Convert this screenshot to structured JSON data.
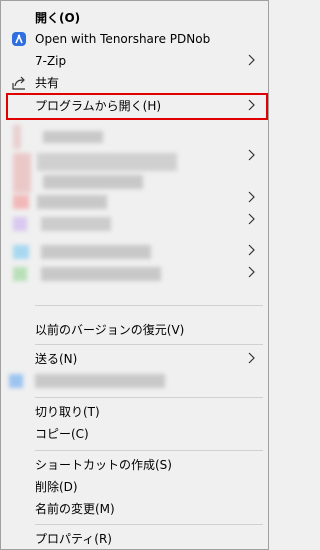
{
  "menu": {
    "items": [
      {
        "label": "開く(O)"
      },
      {
        "label": "Open with Tenorshare PDNob"
      },
      {
        "label": "7-Zip"
      },
      {
        "label": "共有"
      },
      {
        "label": "プログラムから開く(H)"
      },
      {
        "label": "以前のバージョンの復元(V)"
      },
      {
        "label": "送る(N)"
      },
      {
        "label": "切り取り(T)"
      },
      {
        "label": "コピー(C)"
      },
      {
        "label": "ショートカットの作成(S)"
      },
      {
        "label": "削除(D)"
      },
      {
        "label": "名前の変更(M)"
      },
      {
        "label": "プロパティ(R)"
      }
    ]
  },
  "icons": {
    "pdnob": "pdnob-icon",
    "share": "share-icon",
    "submenu": "chevron-right-icon"
  },
  "colors": {
    "highlight_border": "#e00000",
    "pdnob_icon": "#2f6fe0"
  }
}
